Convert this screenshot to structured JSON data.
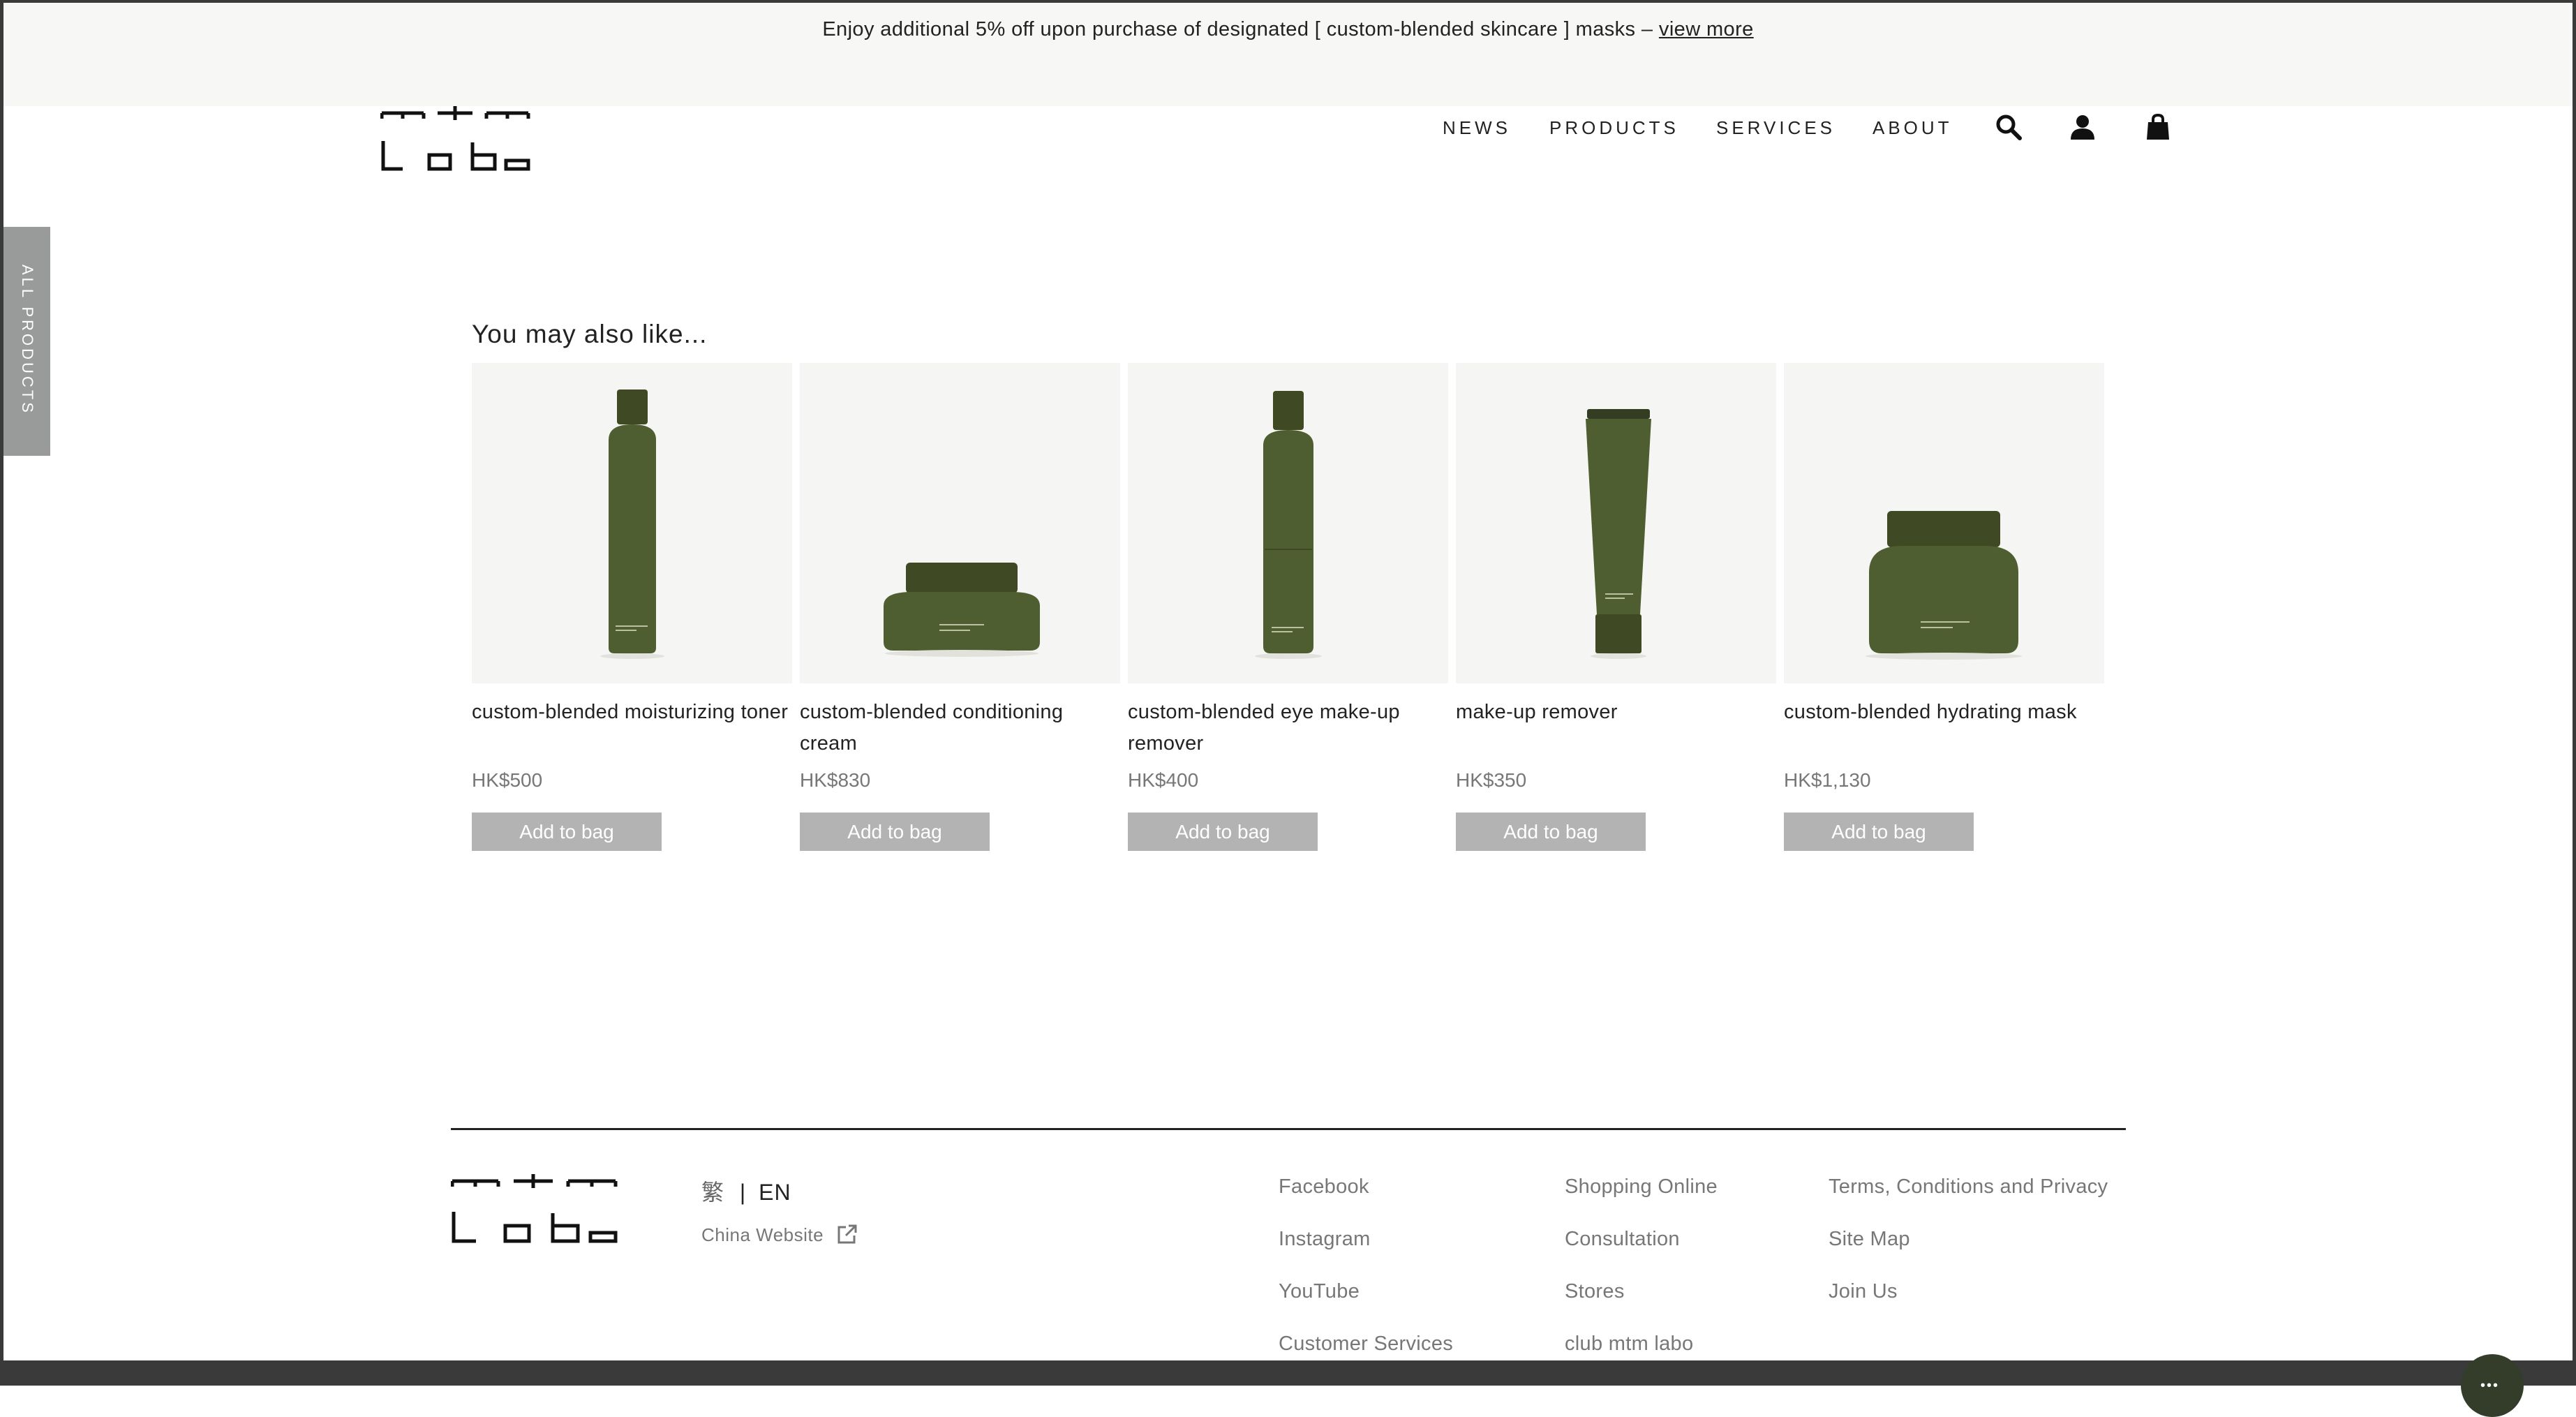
{
  "promo": {
    "text": "Enjoy additional 5% off upon purchase of designated [ custom-blended skincare ] masks –",
    "link": "view more"
  },
  "header": {
    "logo_icon": "mtm-labo-logo",
    "nav": [
      "NEWS",
      "PRODUCTS",
      "SERVICES",
      "ABOUT"
    ],
    "icons": [
      "search-icon",
      "account-icon",
      "bag-icon"
    ]
  },
  "side_tab": {
    "label": "ALL PRODUCTS"
  },
  "recommendations": {
    "title": "You may also like...",
    "products": [
      {
        "name": "custom-blended moisturizing toner",
        "price": "HK$500",
        "button": "Add to bag",
        "image": "tall-bottle"
      },
      {
        "name": "custom-blended conditioning cream",
        "price": "HK$830",
        "button": "Add to bag",
        "image": "low-jar"
      },
      {
        "name": "custom-blended eye make-up remover",
        "price": "HK$400",
        "button": "Add to bag",
        "image": "tall-bottle"
      },
      {
        "name": "make-up remover",
        "price": "HK$350",
        "button": "Add to bag",
        "image": "tube"
      },
      {
        "name": "custom-blended hydrating mask",
        "price": "HK$1,130",
        "button": "Add to bag",
        "image": "large-jar"
      }
    ]
  },
  "footer": {
    "language": {
      "zh": "繁",
      "separator": "|",
      "en": "EN"
    },
    "china_website": "China Website",
    "columns": [
      [
        "Facebook",
        "Instagram",
        "YouTube",
        "Customer Services"
      ],
      [
        "Shopping Online",
        "Consultation",
        "Stores",
        "club mtm labo"
      ],
      [
        "Terms, Conditions and Privacy",
        "Site Map",
        "Join Us"
      ]
    ]
  },
  "colors": {
    "promo_bg": "#f7f7f5",
    "product_green": "#4f5e31",
    "button_grey": "#b3b3b3",
    "side_tab_grey": "#999a9a"
  }
}
